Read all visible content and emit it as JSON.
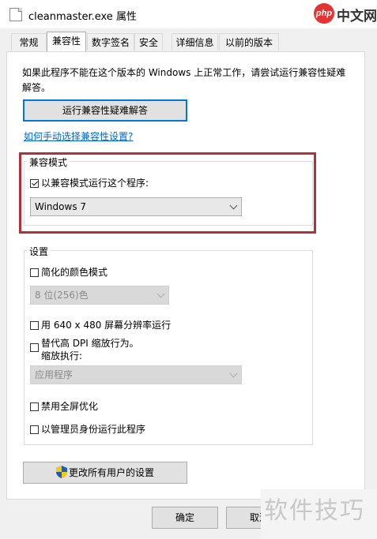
{
  "window": {
    "title": "cleanmaster.exe 属性"
  },
  "watermark_logo": {
    "php": "php",
    "cn": "中文网"
  },
  "tabs": [
    {
      "label": "常规"
    },
    {
      "label": "兼容性",
      "active": true
    },
    {
      "label": "数字签名"
    },
    {
      "label": "安全"
    },
    {
      "label": "详细信息"
    },
    {
      "label": "以前的版本"
    }
  ],
  "intro_text": "如果此程序不能在这个版本的 Windows 上正常工作，请尝试运行兼容性疑难解答。",
  "troubleshoot_button": "运行兼容性疑难解答",
  "manual_link": "如何手动选择兼容性设置?",
  "compat_mode": {
    "group_label": "兼容模式",
    "checkbox_label": "以兼容模式运行这个程序:",
    "checked": true,
    "os_selected": "Windows 7"
  },
  "settings": {
    "group_label": "设置",
    "reduced_color_label": "简化的颜色模式",
    "color_selected": "8 位(256)色",
    "res_640_label": "用 640 x 480 屏幕分辨率运行",
    "dpi_label_line1": "替代高 DPI 缩放行为。",
    "dpi_label_line2": "缩放执行:",
    "dpi_selected": "应用程序",
    "fullscreen_label": "禁用全屏优化",
    "admin_label": "以管理员身份运行此程序"
  },
  "all_users_button": "更改所有用户的设置",
  "ok_button": "确定",
  "cancel_button": "取消",
  "watermark_text": "软件技巧"
}
